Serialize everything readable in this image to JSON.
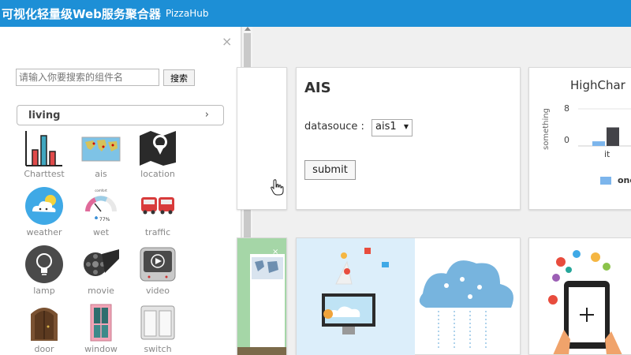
{
  "header": {
    "title": "可视化轻量级Web服务聚合器",
    "subtitle": "PizzaHub"
  },
  "sidebar": {
    "close_glyph": "×",
    "search_placeholder": "请输入你要搜索的组件名",
    "search_button": "搜索",
    "category": "living",
    "category_chevron": "›",
    "widgets": [
      {
        "label": "Charttest",
        "icon": "bar-chart-icon"
      },
      {
        "label": "ais",
        "icon": "world-map-icon"
      },
      {
        "label": "location",
        "icon": "map-pin-icon"
      },
      {
        "label": "weather",
        "icon": "cloud-sun-icon"
      },
      {
        "label": "wet",
        "icon": "gauge-icon"
      },
      {
        "label": "traffic",
        "icon": "buses-icon"
      },
      {
        "label": "lamp",
        "icon": "lightbulb-icon"
      },
      {
        "label": "movie",
        "icon": "film-reel-icon"
      },
      {
        "label": "video",
        "icon": "tv-play-icon"
      },
      {
        "label": "door",
        "icon": "door-icon"
      },
      {
        "label": "window",
        "icon": "window-icon"
      },
      {
        "label": "switch",
        "icon": "switch-icon"
      }
    ],
    "gauge_top": "comfort",
    "gauge_value": "77%"
  },
  "ais_card": {
    "title": "AIS",
    "datasource_label": "datasouce :",
    "datasource_value": "ais1",
    "submit_label": "submit"
  },
  "highchart_card": {
    "title": "HighChar",
    "legend_label": "one",
    "colors": {
      "series_one": "#7cb5ec",
      "series_two": "#434348"
    },
    "chart_data": {
      "type": "bar",
      "title": "HighChar",
      "ylabel": "something",
      "categories": [
        "it"
      ],
      "yticks": [
        0,
        8
      ],
      "series": [
        {
          "name": "one",
          "values": [
            1
          ]
        },
        {
          "values": [
            4
          ]
        }
      ]
    }
  }
}
